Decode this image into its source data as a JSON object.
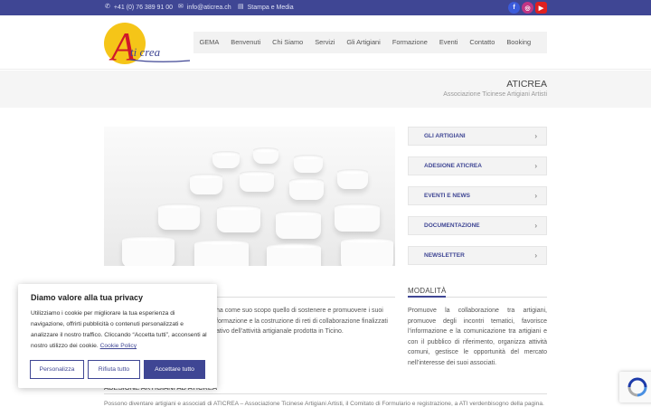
{
  "topbar": {
    "phone": "+41 (0) 76 389 91 00",
    "email": "info@aticrea.ch",
    "press": "Stampa e Media",
    "social": [
      {
        "name": "facebook",
        "glyph": "f",
        "color": "#3b5bdb"
      },
      {
        "name": "instagram",
        "glyph": "◎",
        "color": "#c13584"
      },
      {
        "name": "youtube",
        "glyph": "▶",
        "color": "#e02020"
      }
    ]
  },
  "logo": {
    "letter": "A",
    "word": "ti crea"
  },
  "nav": [
    "GEMA",
    "Benvenuti",
    "Chi Siamo",
    "Servizi",
    "Gli Artigiani",
    "Formazione",
    "Eventi",
    "Contatto",
    "Booking"
  ],
  "page": {
    "title": "ATICREA",
    "subtitle": "Associazione Ticinese Artigiani Artisti"
  },
  "sidebar": [
    {
      "label": "GLI ARTIGIANI"
    },
    {
      "label": "ADESIONE ATICREA"
    },
    {
      "label": "EVENTI E NEWS"
    },
    {
      "label": "DOCUMENTAZIONE"
    },
    {
      "label": "NEWSLETTER"
    }
  ],
  "intro": {
    "lines": [
      "ha come suo scopo quello di sostenere e promuovere i suoi",
      "formazione e la costruzione di reti di collaborazione finalizzati",
      "ativo dell’attività artigianale prodotta in Ticino."
    ]
  },
  "modalita": {
    "heading": "MODALITÀ",
    "text": "Promuove la collaborazione tra artigiani, promuove degli incontri tematici, favorisce l’informazione e la comunicazione tra artigiani e con il pubblico di riferimento, organizza attività comuni, gestisce le opportunità del mercato nell’interesse dei suoi associati."
  },
  "adesione": {
    "heading": "ADESIONE ARTIGIANI AD ATICREA",
    "text": "Possono diventare artigiani e associati di ATICREA – Associazione Ticinese Artigiani Artisti, il Comitato di Formulario e registrazione, a ATI verdenbisogno della pagina."
  },
  "cookie": {
    "title": "Diamo valore alla tua privacy",
    "text": "Utilizziamo i cookie per migliorare la tua esperienza di navigazione, offrirti pubblicità o contenuti personalizzati e analizzare il nostro traffico. Cliccando “Accetta tutti”, acconsenti al nostro utilizzo dei cookie.",
    "link": "Cookie Policy",
    "buttons": {
      "customize": "Personalizza",
      "reject": "Rifiuta tutto",
      "accept": "Accettare tutto"
    }
  },
  "colors": {
    "brand": "#3f4694",
    "logo_yellow": "#f5c518",
    "logo_red": "#d0182a"
  }
}
